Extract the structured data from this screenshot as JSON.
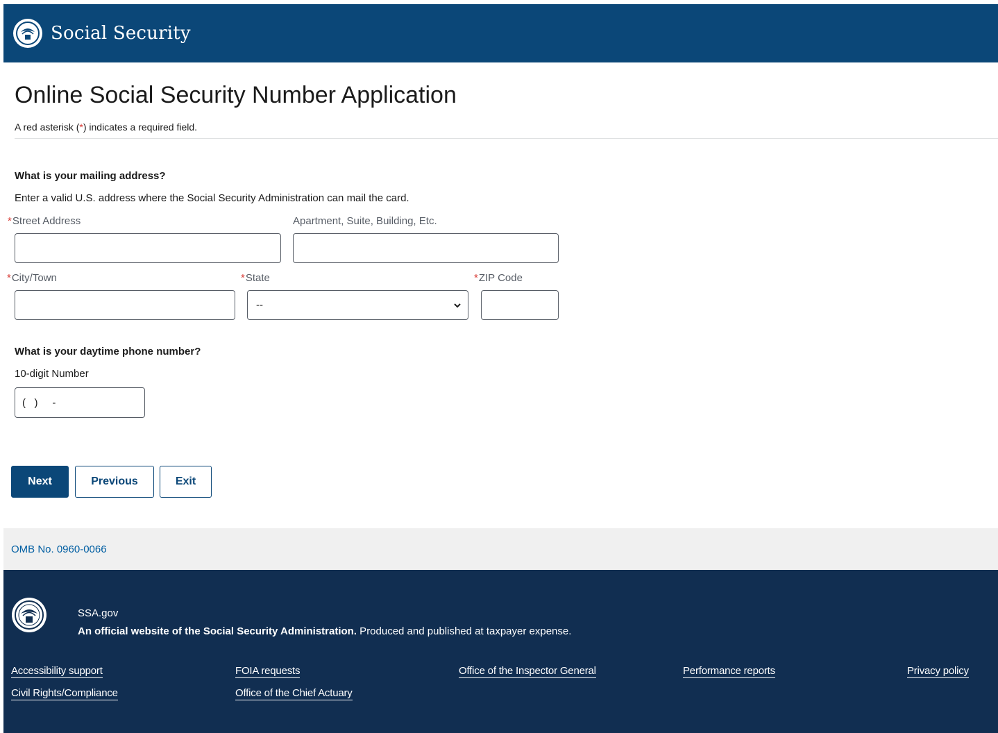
{
  "header": {
    "brand": "Social Security",
    "logo_icon": "ssa-seal-icon"
  },
  "page": {
    "title": "Online Social Security Number Application",
    "required_note_prefix": "A red asterisk (",
    "required_note_asterisk": "*",
    "required_note_suffix": ") indicates a required field."
  },
  "mailing": {
    "question": "What is your mailing address?",
    "hint": "Enter a valid U.S. address where the Social Security Administration can mail the card.",
    "street_label": "Street Address",
    "street_value": "",
    "apartment_label": "Apartment, Suite, Building, Etc.",
    "apartment_value": "",
    "city_label": "City/Town",
    "city_value": "",
    "state_label": "State",
    "state_selected": "--",
    "zip_label": "ZIP Code",
    "zip_value": ""
  },
  "phone": {
    "question": "What is your daytime phone number?",
    "label": "10-digit Number",
    "mask": "(   )     -"
  },
  "buttons": {
    "next": "Next",
    "previous": "Previous",
    "exit": "Exit"
  },
  "omb": {
    "text": "OMB No. 0960-0066"
  },
  "footer": {
    "site": "SSA.gov",
    "desc_bold": "An official website of the Social Security Administration.",
    "desc_rest": " Produced and published at taxpayer expense.",
    "links": {
      "accessibility": "Accessibility support",
      "foia": "FOIA requests",
      "inspector": "Office of the Inspector General",
      "performance": "Performance reports",
      "privacy": "Privacy policy",
      "civil_rights": "Civil Rights/Compliance",
      "actuary": "Office of the Chief Actuary"
    }
  },
  "colors": {
    "header_bg": "#0b4778",
    "footer_bg": "#112e51",
    "required_red": "#d83933",
    "link_blue": "#005ea2"
  }
}
